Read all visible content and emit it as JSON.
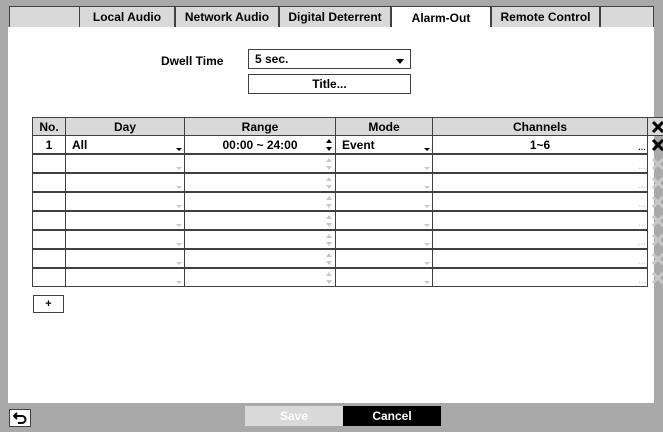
{
  "tabs": [
    {
      "label": "Local Audio"
    },
    {
      "label": "Network Audio"
    },
    {
      "label": "Digital Deterrent"
    },
    {
      "label": "Alarm-Out"
    },
    {
      "label": "Remote Control"
    }
  ],
  "active_tab": "Alarm-Out",
  "dwell": {
    "label": "Dwell Time",
    "value": "5 sec."
  },
  "title_button": "Title...",
  "table": {
    "headers": {
      "no": "No.",
      "day": "Day",
      "range": "Range",
      "mode": "Mode",
      "channels": "Channels"
    },
    "rows": [
      {
        "no": "1",
        "day": "All",
        "range": "00:00 ~ 24:00",
        "mode": "Event",
        "channels": "1~6"
      }
    ],
    "empty_row_count": 7
  },
  "add_button": "+",
  "footer": {
    "save": "Save",
    "cancel": "Cancel"
  },
  "colors": {
    "frame": "#a9a9a9",
    "header": "#d9d9d9",
    "disabled": "#c8c8c8",
    "cancel_bg": "#000000"
  },
  "icons": {
    "delete": "close-icon",
    "back": "back-arrow-icon"
  }
}
